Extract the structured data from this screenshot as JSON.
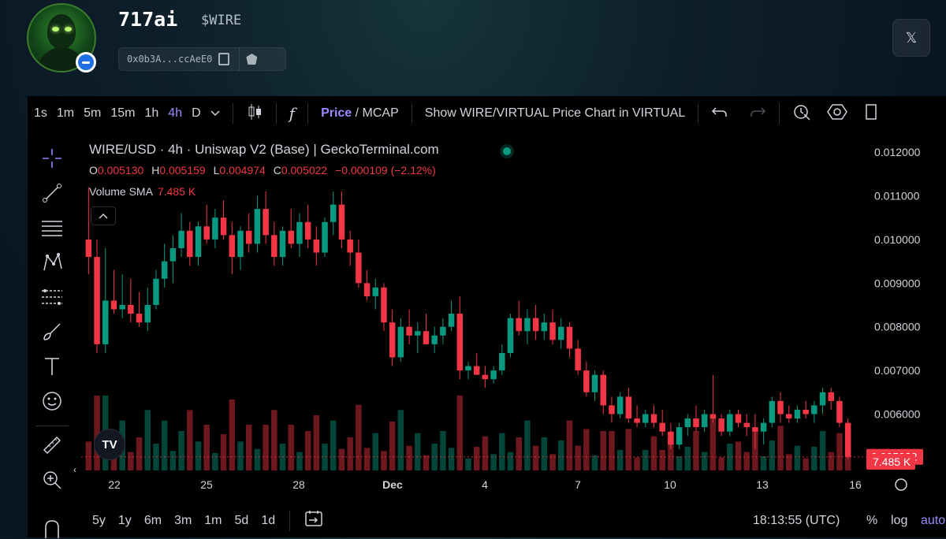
{
  "token": {
    "name": "717ai",
    "ticker": "$WIRE",
    "address": "0x0b3A...ccAeE0",
    "x_icon": "𝕏"
  },
  "toolbar": {
    "intervals": [
      "1s",
      "1m",
      "5m",
      "15m",
      "1h",
      "4h",
      "D"
    ],
    "active_interval": "4h",
    "fx_label": "f",
    "price_label": "Price",
    "slash": " / ",
    "mcap_label": "MCAP",
    "show_label": "Show WIRE/VIRTUAL Price Chart in VIRTUAL"
  },
  "legend": {
    "title": "WIRE/USD · 4h · Uniswap V2 (Base) | GeckoTerminal.com",
    "o_label": "O",
    "o": "0.005130",
    "h_label": "H",
    "h": "0.005159",
    "l_label": "L",
    "l": "0.004974",
    "c_label": "C",
    "c": "0.005022",
    "change": "−0.000109 (−2.12%)",
    "volume_label": "Volume SMA",
    "volume_value": "7.485 K"
  },
  "bottom": {
    "ranges": [
      "5y",
      "1y",
      "6m",
      "3m",
      "1m",
      "5d",
      "1d"
    ],
    "clock": "18:13:55 (UTC)",
    "percent": "%",
    "log": "log",
    "auto": "auto"
  },
  "chart_data": {
    "type": "candlestick",
    "pair": "WIRE/USD",
    "interval": "4h",
    "x_ticks": [
      "22",
      "25",
      "28",
      "Dec",
      "4",
      "7",
      "10",
      "13",
      "16"
    ],
    "y_ticks": [
      "0.012000",
      "0.011000",
      "0.010000",
      "0.009000",
      "0.008000",
      "0.007000",
      "0.006000"
    ],
    "ylim": [
      0.0048,
      0.0122
    ],
    "last_price": "0.005022",
    "last_volume": "7.485 K",
    "colors": {
      "up": "#089981",
      "down": "#f23645",
      "text": "#d1d4dc",
      "accent": "#9c8cff"
    },
    "candles": [
      [
        0.01,
        0.0112,
        0.0092,
        0.0096
      ],
      [
        0.0096,
        0.01,
        0.0074,
        0.0076
      ],
      [
        0.0076,
        0.0098,
        0.0074,
        0.0086
      ],
      [
        0.0086,
        0.0093,
        0.0083,
        0.0084
      ],
      [
        0.0084,
        0.0092,
        0.0082,
        0.0085
      ],
      [
        0.0085,
        0.0091,
        0.0081,
        0.0083
      ],
      [
        0.0083,
        0.0088,
        0.008,
        0.0081
      ],
      [
        0.0081,
        0.0089,
        0.0079,
        0.0085
      ],
      [
        0.0085,
        0.0093,
        0.0084,
        0.0091
      ],
      [
        0.0091,
        0.0099,
        0.0089,
        0.0095
      ],
      [
        0.0095,
        0.0101,
        0.009,
        0.0098
      ],
      [
        0.0098,
        0.0106,
        0.0096,
        0.0102
      ],
      [
        0.0102,
        0.0104,
        0.0094,
        0.0096
      ],
      [
        0.0096,
        0.0104,
        0.0094,
        0.0103
      ],
      [
        0.0103,
        0.0108,
        0.0099,
        0.01
      ],
      [
        0.01,
        0.0107,
        0.0098,
        0.0105
      ],
      [
        0.0105,
        0.0109,
        0.01,
        0.0101
      ],
      [
        0.0101,
        0.0104,
        0.0092,
        0.0096
      ],
      [
        0.0096,
        0.0103,
        0.0093,
        0.0102
      ],
      [
        0.0102,
        0.0106,
        0.0097,
        0.0099
      ],
      [
        0.0099,
        0.011,
        0.0097,
        0.0107
      ],
      [
        0.0107,
        0.0111,
        0.0099,
        0.0101
      ],
      [
        0.0101,
        0.0104,
        0.0094,
        0.0096
      ],
      [
        0.0096,
        0.0103,
        0.0094,
        0.0102
      ],
      [
        0.0102,
        0.0107,
        0.0098,
        0.0099
      ],
      [
        0.0099,
        0.0106,
        0.0096,
        0.0104
      ],
      [
        0.0104,
        0.0108,
        0.0098,
        0.01
      ],
      [
        0.01,
        0.0103,
        0.0094,
        0.0097
      ],
      [
        0.0097,
        0.0105,
        0.0096,
        0.0104
      ],
      [
        0.0104,
        0.0111,
        0.0101,
        0.0108
      ],
      [
        0.0108,
        0.0111,
        0.0098,
        0.01
      ],
      [
        0.01,
        0.0102,
        0.0094,
        0.0097
      ],
      [
        0.0097,
        0.01,
        0.0089,
        0.009
      ],
      [
        0.009,
        0.0093,
        0.0086,
        0.0087
      ],
      [
        0.0087,
        0.0091,
        0.0084,
        0.0089
      ],
      [
        0.0089,
        0.009,
        0.0079,
        0.0081
      ],
      [
        0.0081,
        0.0084,
        0.0071,
        0.0073
      ],
      [
        0.0073,
        0.0082,
        0.0072,
        0.008
      ],
      [
        0.008,
        0.0084,
        0.0076,
        0.0078
      ],
      [
        0.0078,
        0.0081,
        0.0074,
        0.0079
      ],
      [
        0.0079,
        0.0083,
        0.0076,
        0.0076
      ],
      [
        0.0076,
        0.008,
        0.0074,
        0.0078
      ],
      [
        0.0078,
        0.0082,
        0.0076,
        0.008
      ],
      [
        0.008,
        0.0086,
        0.0079,
        0.0083
      ],
      [
        0.0083,
        0.0087,
        0.0068,
        0.007
      ],
      [
        0.007,
        0.0072,
        0.0068,
        0.0071
      ],
      [
        0.0071,
        0.0074,
        0.0069,
        0.0069
      ],
      [
        0.0069,
        0.0071,
        0.0066,
        0.0068
      ],
      [
        0.0068,
        0.0071,
        0.0067,
        0.007
      ],
      [
        0.007,
        0.0076,
        0.0069,
        0.0074
      ],
      [
        0.0074,
        0.0083,
        0.0073,
        0.0082
      ],
      [
        0.0082,
        0.0086,
        0.0078,
        0.0079
      ],
      [
        0.0079,
        0.0084,
        0.0076,
        0.0082
      ],
      [
        0.0082,
        0.0085,
        0.0077,
        0.0079
      ],
      [
        0.0079,
        0.0083,
        0.0077,
        0.0081
      ],
      [
        0.0081,
        0.0084,
        0.0076,
        0.0077
      ],
      [
        0.0077,
        0.0082,
        0.0075,
        0.008
      ],
      [
        0.008,
        0.0081,
        0.0073,
        0.0075
      ],
      [
        0.0075,
        0.0077,
        0.0069,
        0.007
      ],
      [
        0.007,
        0.0072,
        0.0064,
        0.0065
      ],
      [
        0.0065,
        0.007,
        0.0063,
        0.0069
      ],
      [
        0.0069,
        0.007,
        0.006,
        0.0062
      ],
      [
        0.0062,
        0.0064,
        0.0058,
        0.006
      ],
      [
        0.006,
        0.0065,
        0.0059,
        0.0064
      ],
      [
        0.0064,
        0.0066,
        0.0058,
        0.0059
      ],
      [
        0.0059,
        0.0062,
        0.0057,
        0.0058
      ],
      [
        0.0058,
        0.0061,
        0.0057,
        0.006
      ],
      [
        0.006,
        0.0062,
        0.0057,
        0.0058
      ],
      [
        0.0058,
        0.0061,
        0.0055,
        0.0056
      ],
      [
        0.0056,
        0.0058,
        0.0052,
        0.0053
      ],
      [
        0.0053,
        0.0058,
        0.0052,
        0.0057
      ],
      [
        0.0057,
        0.006,
        0.0055,
        0.0059
      ],
      [
        0.0059,
        0.0062,
        0.0056,
        0.0057
      ],
      [
        0.0057,
        0.0061,
        0.0056,
        0.006
      ],
      [
        0.006,
        0.0069,
        0.0058,
        0.0059
      ],
      [
        0.0059,
        0.006,
        0.0055,
        0.0056
      ],
      [
        0.0056,
        0.0061,
        0.0055,
        0.006
      ],
      [
        0.006,
        0.0061,
        0.0057,
        0.0058
      ],
      [
        0.0058,
        0.006,
        0.0055,
        0.0057
      ],
      [
        0.0057,
        0.006,
        0.0052,
        0.0056
      ],
      [
        0.0056,
        0.0059,
        0.0053,
        0.0058
      ],
      [
        0.0058,
        0.0064,
        0.0057,
        0.0063
      ],
      [
        0.0063,
        0.0065,
        0.0058,
        0.006
      ],
      [
        0.006,
        0.0062,
        0.0058,
        0.0059
      ],
      [
        0.0059,
        0.0062,
        0.0058,
        0.0061
      ],
      [
        0.0061,
        0.0063,
        0.0059,
        0.006
      ],
      [
        0.006,
        0.0063,
        0.0058,
        0.0062
      ],
      [
        0.0062,
        0.0066,
        0.006,
        0.0065
      ],
      [
        0.0065,
        0.0066,
        0.0061,
        0.0063
      ],
      [
        0.0063,
        0.0064,
        0.0057,
        0.0058
      ],
      [
        0.0058,
        0.0059,
        0.00497,
        0.00502
      ]
    ]
  }
}
